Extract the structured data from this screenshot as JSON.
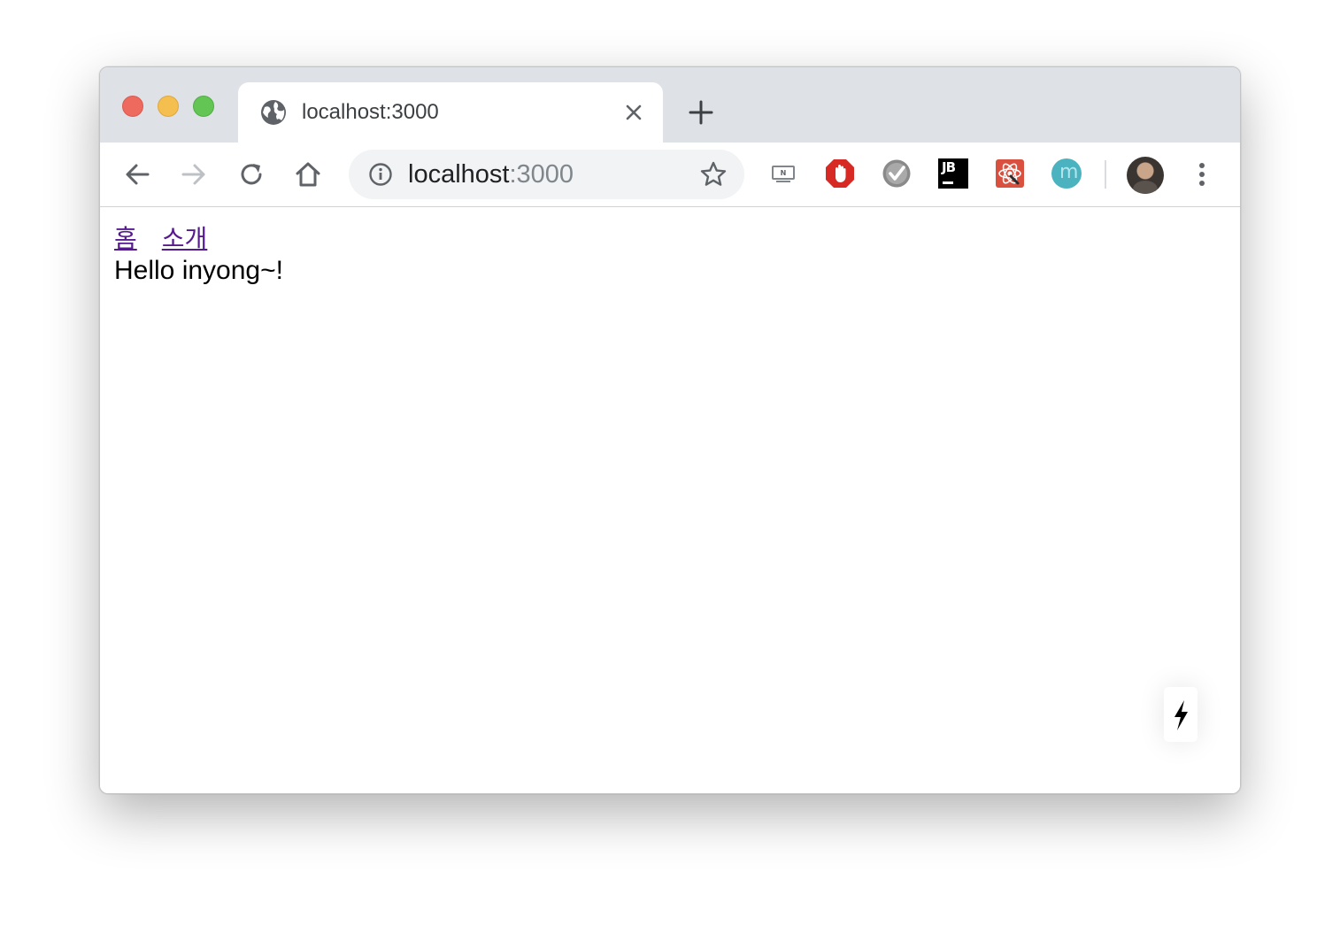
{
  "tab": {
    "title": "localhost:3000",
    "globe_icon": "globe-icon",
    "close_icon": "close-icon"
  },
  "toolbar": {
    "new_tab_icon": "plus-icon",
    "back_icon": "arrow-left-icon",
    "forward_icon": "arrow-right-icon",
    "reload_icon": "reload-icon",
    "home_icon": "home-icon",
    "menu_icon": "more-vertical-icon"
  },
  "address_bar": {
    "host": "localhost",
    "port": ":3000",
    "info_icon": "info-icon",
    "bookmark_icon": "star-icon"
  },
  "extensions": [
    {
      "name": "n-extension-icon"
    },
    {
      "name": "adblock-hand-icon"
    },
    {
      "name": "checkmark-extension-icon"
    },
    {
      "name": "jb-extension-icon",
      "label": "JB"
    },
    {
      "name": "react-devtools-icon"
    },
    {
      "name": "m-extension-icon",
      "label": "m"
    }
  ],
  "page": {
    "links": [
      "홈",
      "소개"
    ],
    "message": "Hello inyong~!"
  },
  "colors": {
    "tabstrip": "#dee1e6",
    "link_visited": "#551a8b",
    "omnibox": "#f1f3f4"
  }
}
